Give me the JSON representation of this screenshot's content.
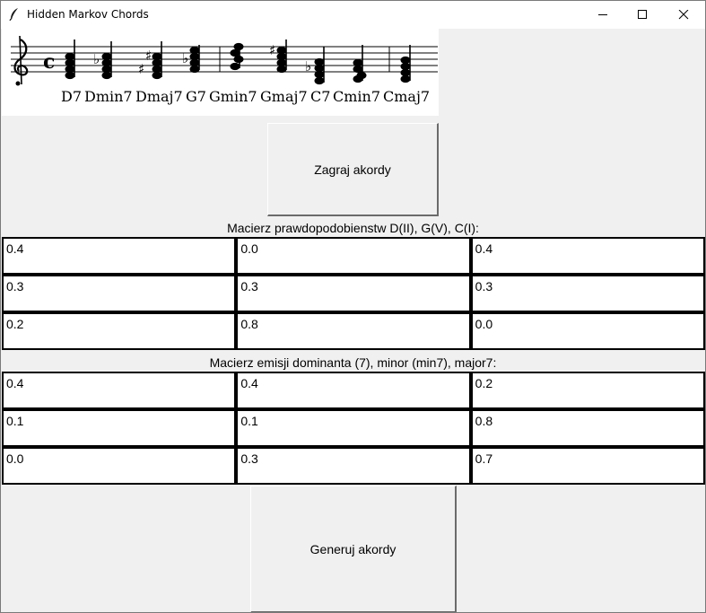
{
  "window": {
    "title": "Hidden Markov Chords"
  },
  "score": {
    "chords": [
      "D7",
      "Dmin7",
      "Dmaj7",
      "G7",
      "Gmin7",
      "Gmaj7",
      "C7",
      "Cmin7",
      "Cmaj7"
    ],
    "time_signature": "c"
  },
  "buttons": {
    "play_label": "Zagraj akordy",
    "generate_label": "Generuj akordy"
  },
  "transition": {
    "label": "Macierz prawdopodobienstw D(II), G(V), C(I):",
    "rows": [
      [
        "0.4",
        "0.0",
        "0.4"
      ],
      [
        "0.3",
        "0.3",
        "0.3"
      ],
      [
        "0.2",
        "0.8",
        "0.0"
      ]
    ]
  },
  "emission": {
    "label": "Macierz emisji dominanta (7), minor (min7), major7:",
    "rows": [
      [
        "0.4",
        "0.4",
        "0.2"
      ],
      [
        "0.1",
        "0.1",
        "0.8"
      ],
      [
        "0.0",
        "0.3",
        "0.7"
      ]
    ]
  }
}
